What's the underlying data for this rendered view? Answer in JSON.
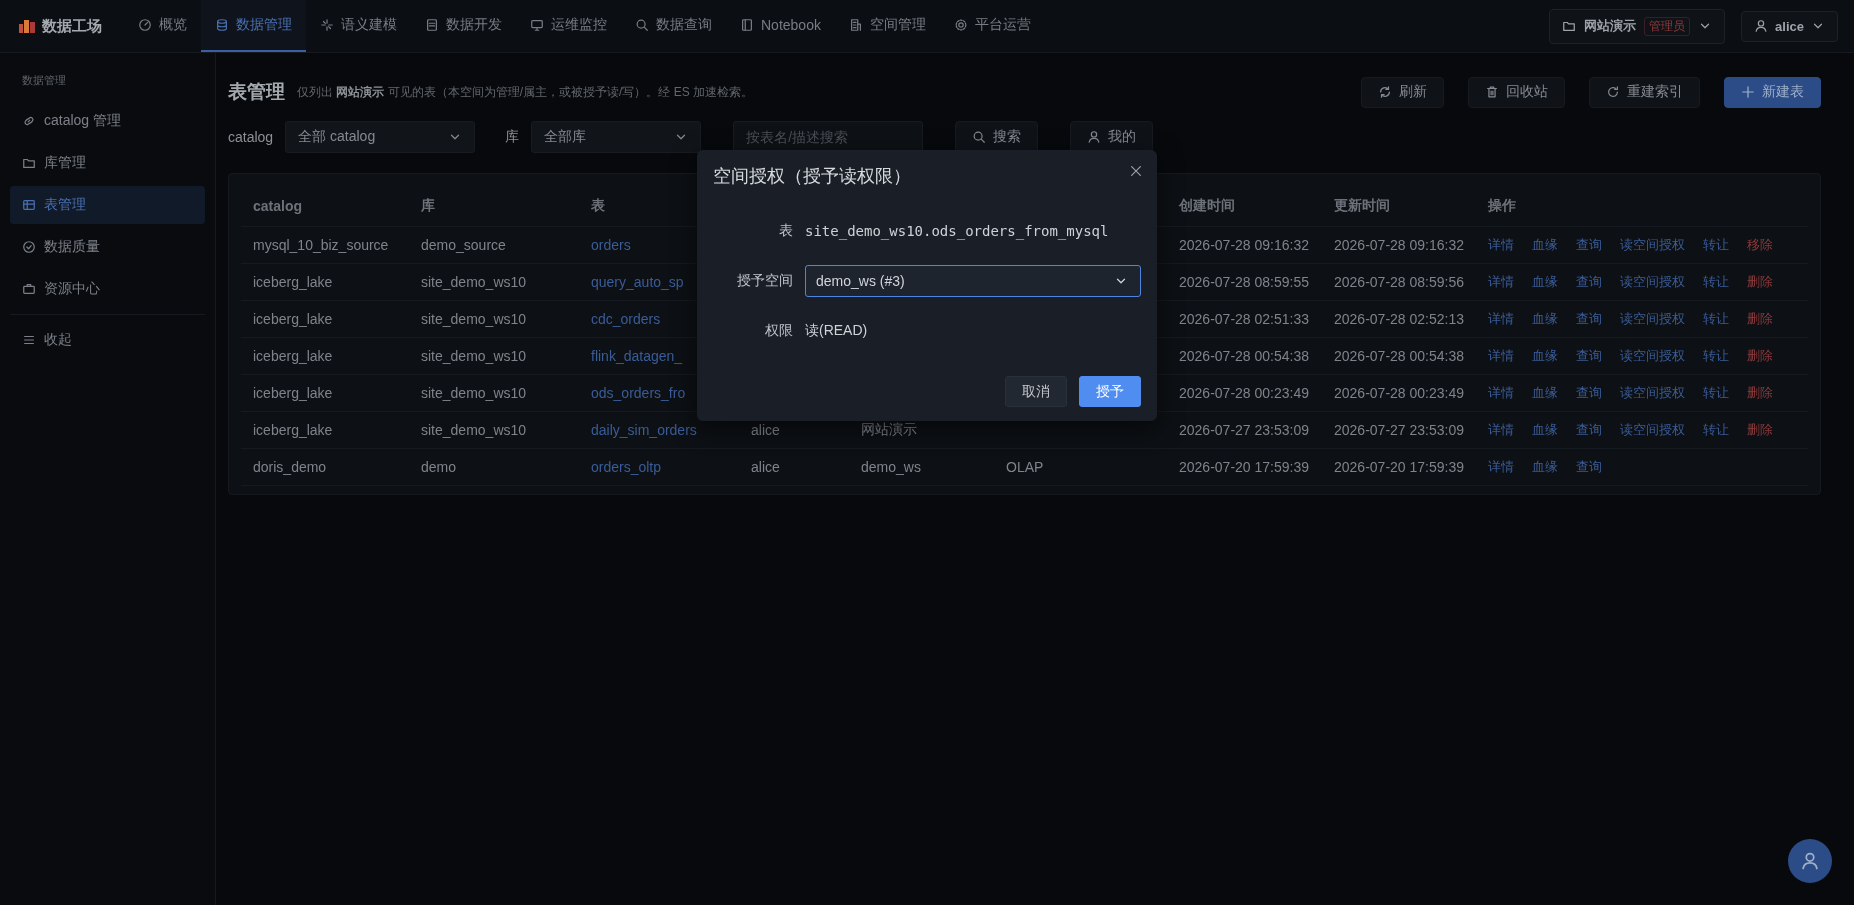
{
  "nav": {
    "brand": "数据工场",
    "tabs": [
      {
        "label": "概览",
        "selected": false
      },
      {
        "label": "数据管理",
        "selected": true
      },
      {
        "label": "语义建模",
        "selected": false
      },
      {
        "label": "数据开发",
        "selected": false
      },
      {
        "label": "运维监控",
        "selected": false
      },
      {
        "label": "数据查询",
        "selected": false
      },
      {
        "label": "Notebook",
        "selected": false
      },
      {
        "label": "空间管理",
        "selected": false
      },
      {
        "label": "平台运营",
        "selected": false
      }
    ],
    "workspace": {
      "name": "网站演示",
      "role": "管理员"
    },
    "user": "alice"
  },
  "sidebar": {
    "section": "数据管理",
    "items": [
      {
        "label": "catalog 管理",
        "selected": false
      },
      {
        "label": "库管理",
        "selected": false
      },
      {
        "label": "表管理",
        "selected": true
      },
      {
        "label": "数据质量",
        "selected": false
      },
      {
        "label": "资源中心",
        "selected": false
      }
    ],
    "collapse": "收起"
  },
  "header": {
    "title": "表管理",
    "description": "仅列出 **网站演示** 可见的表（本空间为管理/属主，或被授予读/写）。经 ES 加速检索。",
    "buttons": [
      {
        "label": "刷新",
        "kind": "default"
      },
      {
        "label": "回收站",
        "kind": "default"
      },
      {
        "label": "重建索引",
        "kind": "default"
      },
      {
        "label": "新建表",
        "kind": "primary"
      }
    ]
  },
  "filters": {
    "catalog_label": "catalog",
    "catalog_value": "全部 catalog",
    "db_label": "库",
    "db_value": "全部库",
    "search": {
      "placeholder": "按表名/描述搜索"
    },
    "search_button": "搜索",
    "mine_button": "我的"
  },
  "table": {
    "columns": [
      "catalog",
      "库",
      "表",
      null,
      null,
      null,
      "创建时间",
      "更新时间",
      "操作"
    ],
    "rows": [
      {
        "catalog": "mysql_10_biz_source",
        "database": "demo_source",
        "table": "orders",
        "created": "2026-07-28 09:16:32",
        "updated": "2026-07-28 09:16:32",
        "actions": [
          {
            "label": "详情",
            "kind": "link"
          },
          {
            "label": "血缘",
            "kind": "link"
          },
          {
            "label": "查询",
            "kind": "link"
          },
          {
            "label": "读空间授权",
            "kind": "link"
          },
          {
            "label": "转让",
            "kind": "link"
          },
          {
            "label": "移除",
            "kind": "danger"
          }
        ]
      },
      {
        "catalog": "iceberg_lake",
        "database": "site_demo_ws10",
        "table": "query_auto_sp",
        "created": "2026-07-28 08:59:55",
        "updated": "2026-07-28 08:59:56",
        "actions": [
          {
            "label": "详情",
            "kind": "link"
          },
          {
            "label": "血缘",
            "kind": "link"
          },
          {
            "label": "查询",
            "kind": "link"
          },
          {
            "label": "读空间授权",
            "kind": "link"
          },
          {
            "label": "转让",
            "kind": "link"
          },
          {
            "label": "删除",
            "kind": "danger"
          }
        ]
      },
      {
        "catalog": "iceberg_lake",
        "database": "site_demo_ws10",
        "table": "cdc_orders",
        "created": "2026-07-28 02:51:33",
        "updated": "2026-07-28 02:52:13",
        "actions": [
          {
            "label": "详情",
            "kind": "link"
          },
          {
            "label": "血缘",
            "kind": "link"
          },
          {
            "label": "查询",
            "kind": "link"
          },
          {
            "label": "读空间授权",
            "kind": "link"
          },
          {
            "label": "转让",
            "kind": "link"
          },
          {
            "label": "删除",
            "kind": "danger"
          }
        ]
      },
      {
        "catalog": "iceberg_lake",
        "database": "site_demo_ws10",
        "table": "flink_datagen_",
        "created": "2026-07-28 00:54:38",
        "updated": "2026-07-28 00:54:38",
        "actions": [
          {
            "label": "详情",
            "kind": "link"
          },
          {
            "label": "血缘",
            "kind": "link"
          },
          {
            "label": "查询",
            "kind": "link"
          },
          {
            "label": "读空间授权",
            "kind": "link"
          },
          {
            "label": "转让",
            "kind": "link"
          },
          {
            "label": "删除",
            "kind": "danger"
          }
        ]
      },
      {
        "catalog": "iceberg_lake",
        "database": "site_demo_ws10",
        "table": "ods_orders_fro",
        "created": "2026-07-28 00:23:49",
        "updated": "2026-07-28 00:23:49",
        "actions": [
          {
            "label": "详情",
            "kind": "link"
          },
          {
            "label": "血缘",
            "kind": "link"
          },
          {
            "label": "查询",
            "kind": "link"
          },
          {
            "label": "读空间授权",
            "kind": "link"
          },
          {
            "label": "转让",
            "kind": "link"
          },
          {
            "label": "删除",
            "kind": "danger"
          }
        ]
      },
      {
        "catalog": "iceberg_lake",
        "database": "site_demo_ws10",
        "table": "daily_sim_orders",
        "owner": "alice",
        "workspace": "网站演示",
        "created": "2026-07-27 23:53:09",
        "updated": "2026-07-27 23:53:09",
        "actions": [
          {
            "label": "详情",
            "kind": "link"
          },
          {
            "label": "血缘",
            "kind": "link"
          },
          {
            "label": "查询",
            "kind": "link"
          },
          {
            "label": "读空间授权",
            "kind": "link"
          },
          {
            "label": "转让",
            "kind": "link"
          },
          {
            "label": "删除",
            "kind": "danger"
          }
        ]
      },
      {
        "catalog": "doris_demo",
        "database": "demo",
        "table": "orders_oltp",
        "owner": "alice",
        "workspace": "demo_ws",
        "type": "OLAP",
        "created": "2026-07-20 17:59:39",
        "updated": "2026-07-20 17:59:39",
        "actions": [
          {
            "label": "详情",
            "kind": "link"
          },
          {
            "label": "血缘",
            "kind": "link"
          },
          {
            "label": "查询",
            "kind": "link"
          }
        ]
      }
    ]
  },
  "dialog": {
    "title": "空间授权（授予读权限）",
    "fields": [
      {
        "label": "表",
        "value": "site_demo_ws10.ods_orders_from_mysql",
        "kind": "mono"
      },
      {
        "label": "授予空间",
        "value": "demo_ws (#3)",
        "kind": "select"
      },
      {
        "label": "权限",
        "value": "读(READ)",
        "kind": "text"
      }
    ],
    "cancel": "取消",
    "confirm": "授予"
  }
}
